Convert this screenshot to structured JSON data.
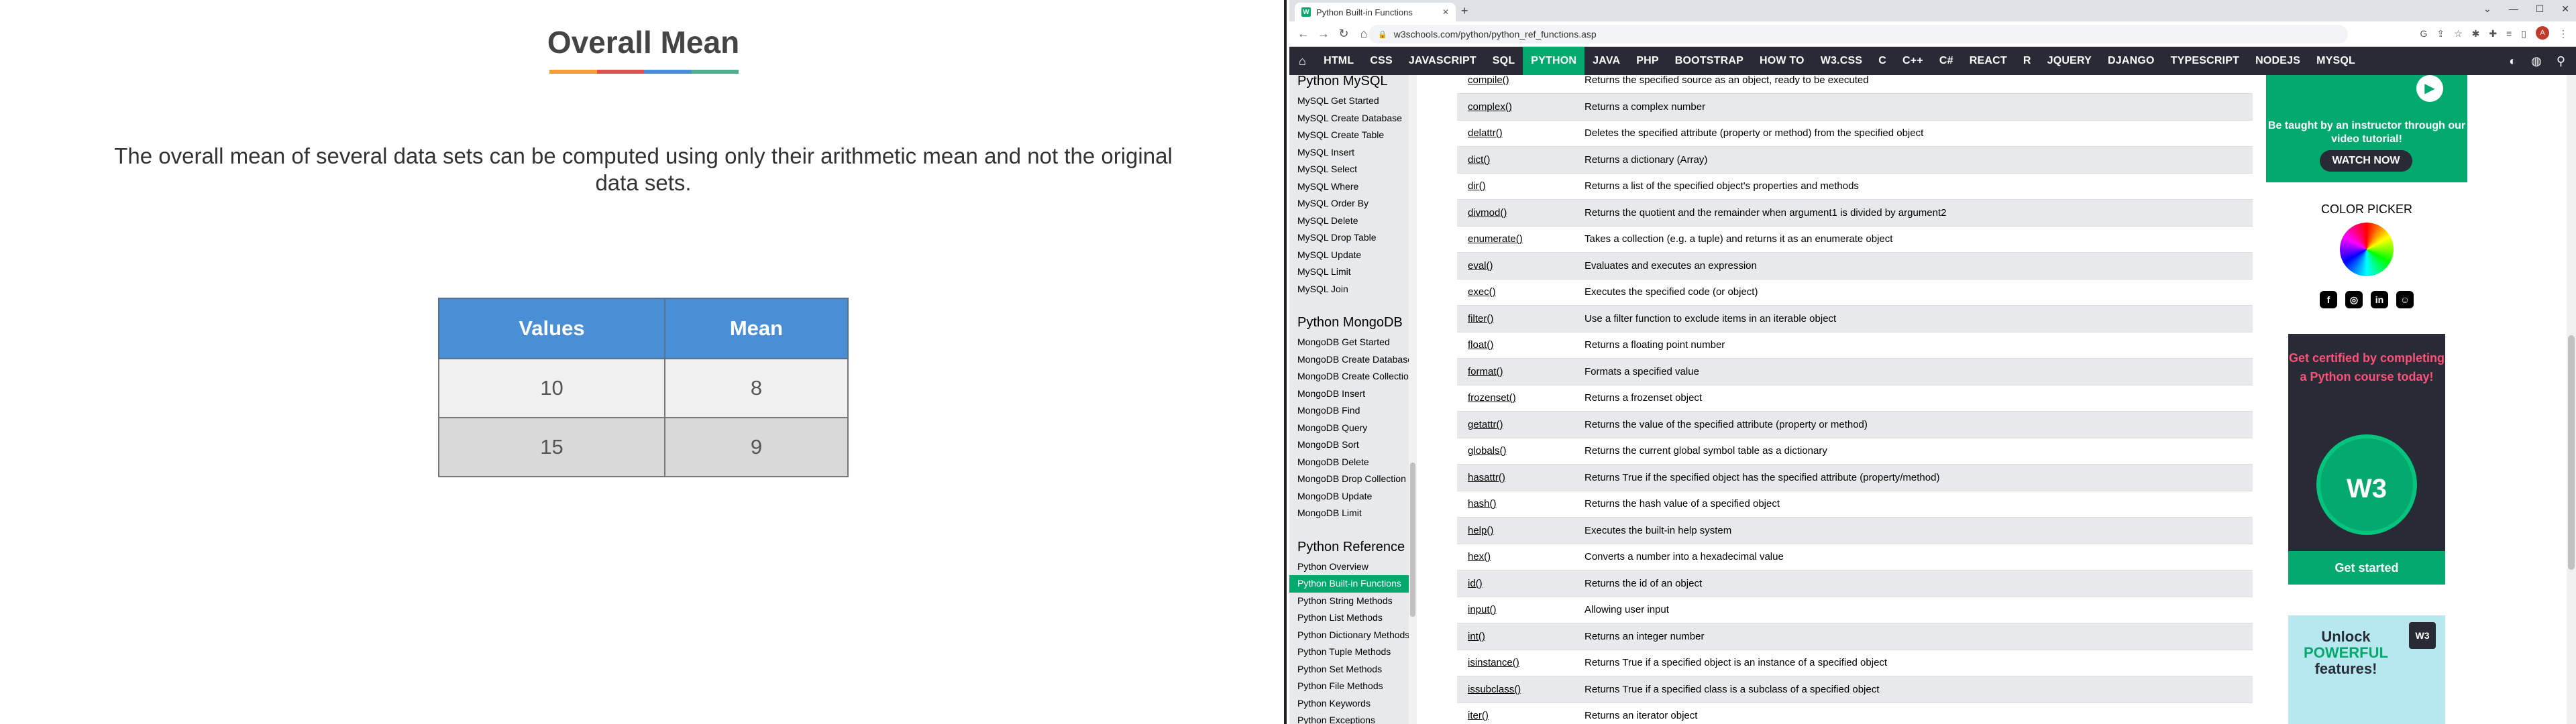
{
  "slide": {
    "title": "Overall Mean",
    "underline_colors": [
      "#f0a030",
      "#e05050",
      "#4a8fd6",
      "#50b090"
    ],
    "body": "The overall mean of several data sets can be computed using only their arithmetic mean and not the original data sets.",
    "table": {
      "headers": [
        "Values",
        "Mean"
      ],
      "rows": [
        [
          "10",
          "8"
        ],
        [
          "15",
          "9"
        ]
      ],
      "header_color": "#4a8fd6"
    }
  },
  "browser": {
    "tab_title": "Python Built-in Functions",
    "favicon": "W",
    "url": "w3schools.com/python/python_ref_functions.asp",
    "avatar_letter": "A",
    "nav": [
      "HTML",
      "CSS",
      "JAVASCRIPT",
      "SQL",
      "PYTHON",
      "JAVA",
      "PHP",
      "BOOTSTRAP",
      "HOW TO",
      "W3.CSS",
      "C",
      "C++",
      "C#",
      "REACT",
      "R",
      "JQUERY",
      "DJANGO",
      "TYPESCRIPT",
      "NODEJS",
      "MYSQL"
    ],
    "nav_active": "PYTHON",
    "accent_color": "#04aa6d",
    "sidebar": {
      "sections": [
        {
          "title": "Python MySQL",
          "items": [
            "MySQL Get Started",
            "MySQL Create Database",
            "MySQL Create Table",
            "MySQL Insert",
            "MySQL Select",
            "MySQL Where",
            "MySQL Order By",
            "MySQL Delete",
            "MySQL Drop Table",
            "MySQL Update",
            "MySQL Limit",
            "MySQL Join"
          ]
        },
        {
          "title": "Python MongoDB",
          "items": [
            "MongoDB Get Started",
            "MongoDB Create Database",
            "MongoDB Create Collection",
            "MongoDB Insert",
            "MongoDB Find",
            "MongoDB Query",
            "MongoDB Sort",
            "MongoDB Delete",
            "MongoDB Drop Collection",
            "MongoDB Update",
            "MongoDB Limit"
          ]
        },
        {
          "title": "Python Reference",
          "items": [
            "Python Overview",
            "Python Built-in Functions",
            "Python String Methods",
            "Python List Methods",
            "Python Dictionary Methods",
            "Python Tuple Methods",
            "Python Set Methods",
            "Python File Methods",
            "Python Keywords",
            "Python Exceptions"
          ]
        }
      ],
      "active_item": "Python Built-in Functions"
    },
    "functions": [
      [
        "compile()",
        "Returns the specified source as an object, ready to be executed"
      ],
      [
        "complex()",
        "Returns a complex number"
      ],
      [
        "delattr()",
        "Deletes the specified attribute (property or method) from the specified object"
      ],
      [
        "dict()",
        "Returns a dictionary (Array)"
      ],
      [
        "dir()",
        "Returns a list of the specified object's properties and methods"
      ],
      [
        "divmod()",
        "Returns the quotient and the remainder when argument1 is divided by argument2"
      ],
      [
        "enumerate()",
        "Takes a collection (e.g. a tuple) and returns it as an enumerate object"
      ],
      [
        "eval()",
        "Evaluates and executes an expression"
      ],
      [
        "exec()",
        "Executes the specified code (or object)"
      ],
      [
        "filter()",
        "Use a filter function to exclude items in an iterable object"
      ],
      [
        "float()",
        "Returns a floating point number"
      ],
      [
        "format()",
        "Formats a specified value"
      ],
      [
        "frozenset()",
        "Returns a frozenset object"
      ],
      [
        "getattr()",
        "Returns the value of the specified attribute (property or method)"
      ],
      [
        "globals()",
        "Returns the current global symbol table as a dictionary"
      ],
      [
        "hasattr()",
        "Returns True if the specified object has the specified attribute (property/method)"
      ],
      [
        "hash()",
        "Returns the hash value of a specified object"
      ],
      [
        "help()",
        "Executes the built-in help system"
      ],
      [
        "hex()",
        "Converts a number into a hexadecimal value"
      ],
      [
        "id()",
        "Returns the id of an object"
      ],
      [
        "input()",
        "Allowing user input"
      ],
      [
        "int()",
        "Returns an integer number"
      ],
      [
        "isinstance()",
        "Returns True if a specified object is an instance of a specified object"
      ],
      [
        "issubclass()",
        "Returns True if a specified class is a subclass of a specified object"
      ],
      [
        "iter()",
        "Returns an iterator object"
      ]
    ],
    "ads": {
      "video_text": "Be taught by an instructor through our video tutorial!",
      "video_button": "WATCH NOW",
      "color_picker_label": "COLOR PICKER",
      "cert_text": "Get certified by completing a Python course today!",
      "cert_badge": "W3",
      "cert_button": "Get started",
      "unlock_line1": "Unlock",
      "unlock_line2": "POWERFUL",
      "unlock_line3": "features!",
      "unlock_logo": "W3"
    }
  }
}
